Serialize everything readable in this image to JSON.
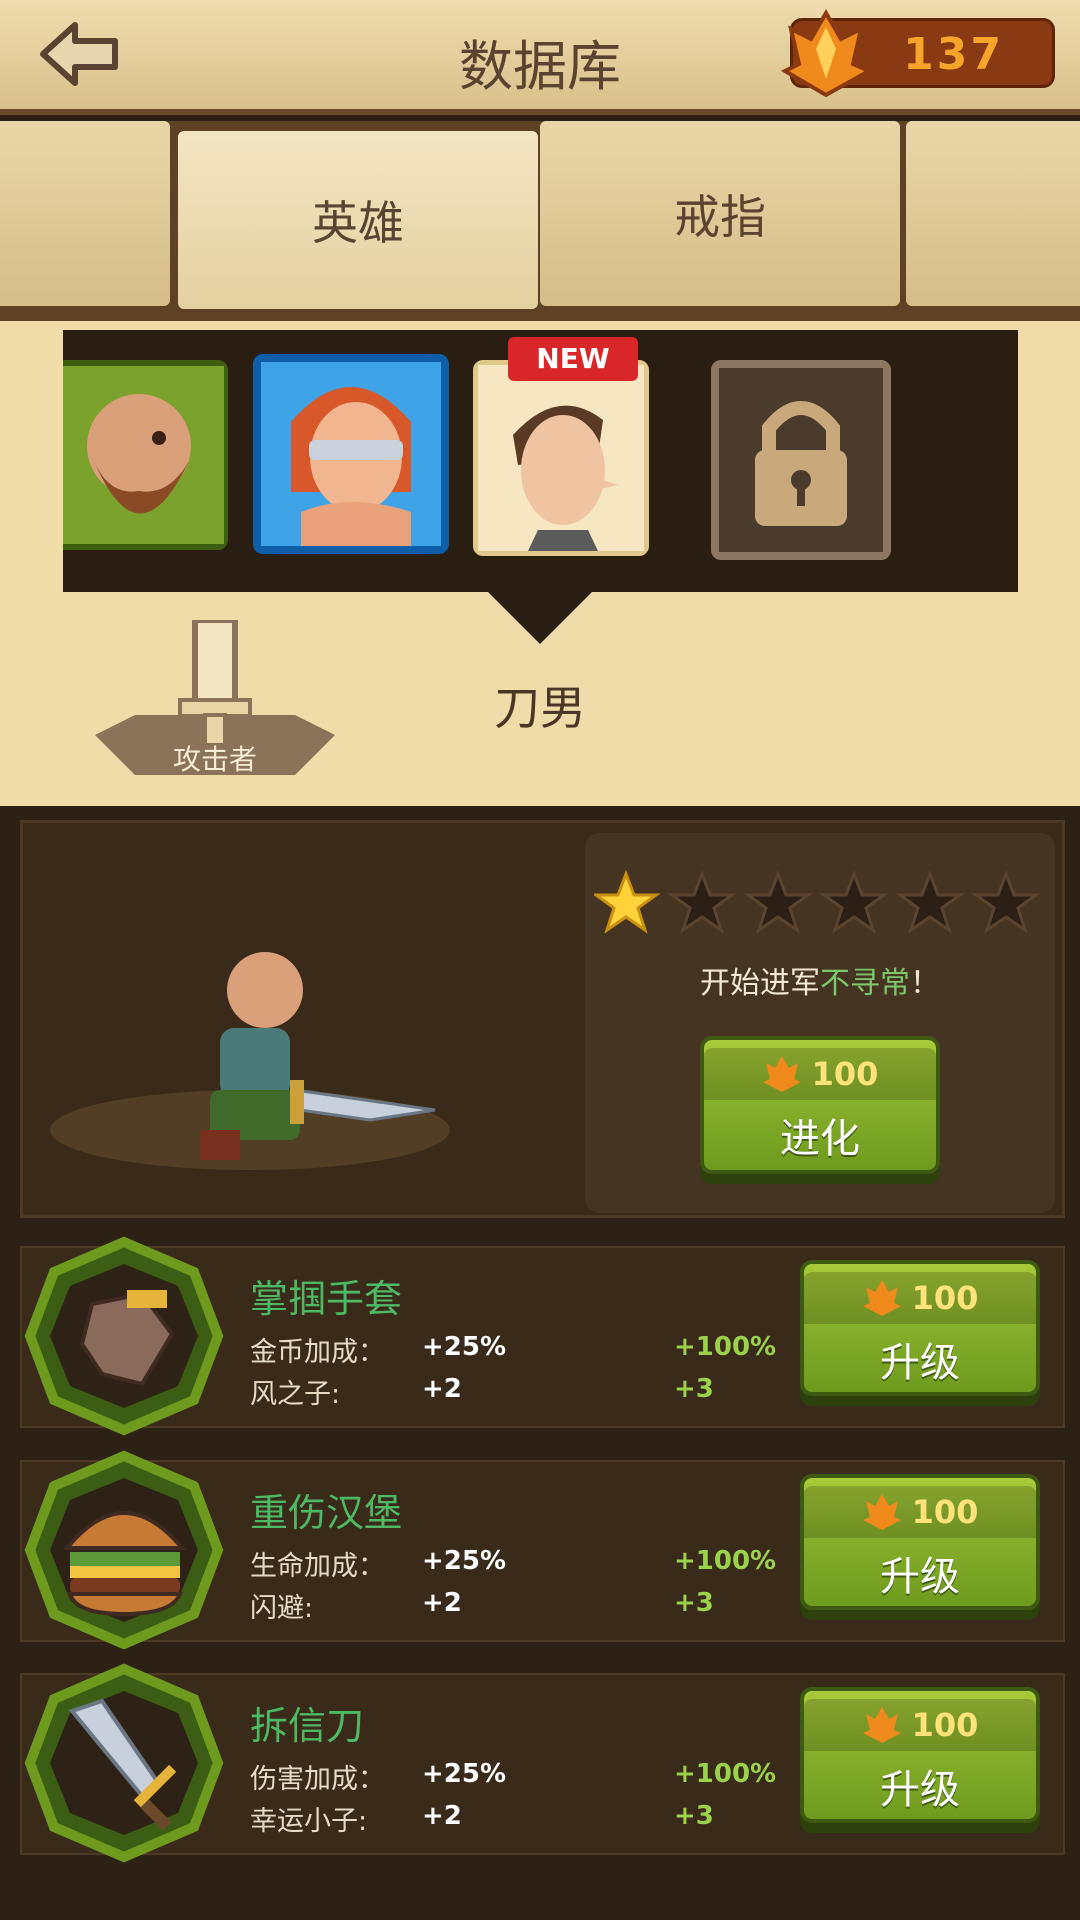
{
  "header": {
    "title": "数据库",
    "currency": "137"
  },
  "tabs": [
    {
      "label": ""
    },
    {
      "label": "英雄"
    },
    {
      "label": "戒指"
    },
    {
      "label": ""
    }
  ],
  "heroes": [
    {
      "name": "dwarf-hero-portrait",
      "state": "owned"
    },
    {
      "name": "blindfolded-hero-portrait",
      "state": "owned"
    },
    {
      "name": "blade-man-portrait",
      "state": "new",
      "badge": "NEW"
    },
    {
      "name": "locked-hero-portrait",
      "state": "locked"
    }
  ],
  "selected_hero": {
    "class": "攻击者",
    "name": "刀男"
  },
  "evolution": {
    "stars_filled": 1,
    "stars_total": 6,
    "text_before": "开始进军",
    "text_highlight": "不寻常",
    "text_after": "！",
    "cost": "100",
    "button_label": "进化"
  },
  "items": [
    {
      "name": "掌掴手套",
      "icon": "glove-icon",
      "stats": [
        {
          "label": "金币加成：",
          "base": "+25%",
          "max": "+100%"
        },
        {
          "label": "风之子:",
          "base": "+2",
          "max": "+3"
        }
      ],
      "cost": "100",
      "button_label": "升级"
    },
    {
      "name": "重伤汉堡",
      "icon": "burger-icon",
      "stats": [
        {
          "label": "生命加成：",
          "base": "+25%",
          "max": "+100%"
        },
        {
          "label": "闪避:",
          "base": "+2",
          "max": "+3"
        }
      ],
      "cost": "100",
      "button_label": "升级"
    },
    {
      "name": "拆信刀",
      "icon": "sword-icon",
      "stats": [
        {
          "label": "伤害加成：",
          "base": "+25%",
          "max": "+100%"
        },
        {
          "label": "幸运小子:",
          "base": "+2",
          "max": "+3"
        }
      ],
      "cost": "100",
      "button_label": "升级"
    }
  ],
  "colors": {
    "accent_green": "#4dba63",
    "button_green": "#88b02b",
    "parchment": "#f0dca8",
    "dark_wood": "#2d2014",
    "currency_orange": "#f5a52a"
  }
}
